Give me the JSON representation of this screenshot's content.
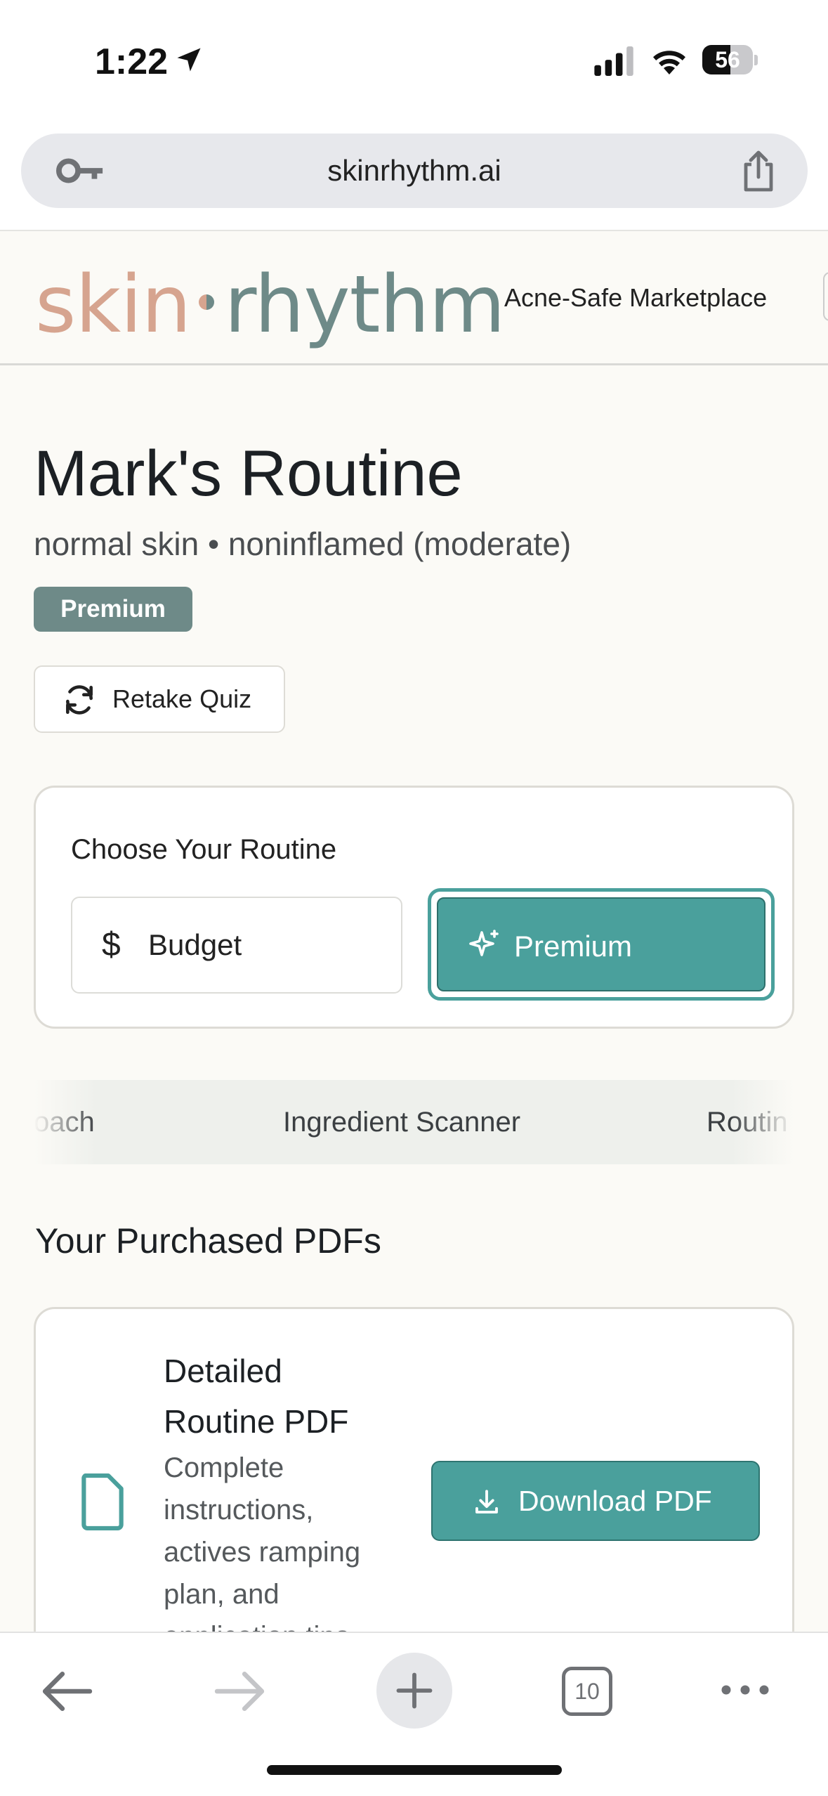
{
  "status_bar": {
    "time": "1:22",
    "battery": "56",
    "battery_level": 0.56
  },
  "browser": {
    "url": "skinrhythm.ai"
  },
  "header": {
    "logo_left": "skin",
    "logo_right": "rhythm",
    "nav_link": "Acne-Safe Marketplace"
  },
  "routine": {
    "title": "Mark's Routine",
    "subtitle": "normal skin • noninflamed (moderate)",
    "tier_badge": "Premium",
    "retake_label": "Retake Quiz"
  },
  "chooser": {
    "title": "Choose Your Routine",
    "options": [
      {
        "label": "Budget",
        "selected": false,
        "icon": "dollar-icon"
      },
      {
        "label": "Premium",
        "selected": true,
        "icon": "sparkles-icon"
      }
    ]
  },
  "tabs": [
    "oach",
    "Ingredient Scanner",
    "Routin"
  ],
  "purchased": {
    "section_title": "Your Purchased PDFs",
    "items": [
      {
        "name": "Detailed Routine PDF",
        "description": "Complete instructions, actives ramping plan, and application tips",
        "button": "Download PDF"
      }
    ]
  },
  "toolbar": {
    "tab_count": "10"
  },
  "colors": {
    "accent": "#4aa09c",
    "brand_sage": "#6e8a88",
    "brand_peach": "#d6a48f",
    "page_bg": "#fbfaf6"
  }
}
